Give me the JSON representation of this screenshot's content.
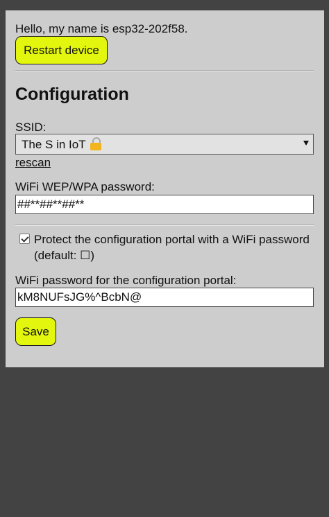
{
  "device": {
    "greeting": "Hello, my name is esp32-202f58.",
    "restart_label": "Restart device"
  },
  "config": {
    "heading": "Configuration",
    "ssid_label": "SSID:",
    "ssid_selected": "The S in IoT",
    "ssid_icon": "lock-icon",
    "rescan_label": "rescan",
    "wifi_password_label": "WiFi WEP/WPA password:",
    "wifi_password_value": "##**##**##**",
    "protect_checked": true,
    "protect_label": "Protect the configuration portal with a WiFi password (default: ☐)",
    "portal_password_label": "WiFi password for the configuration portal:",
    "portal_password_value": "kM8NUFsJG%^BcbN@",
    "save_label": "Save"
  },
  "colors": {
    "background": "#434343",
    "panel": "#cdcdcd",
    "button_accent": "#e3f60d"
  }
}
